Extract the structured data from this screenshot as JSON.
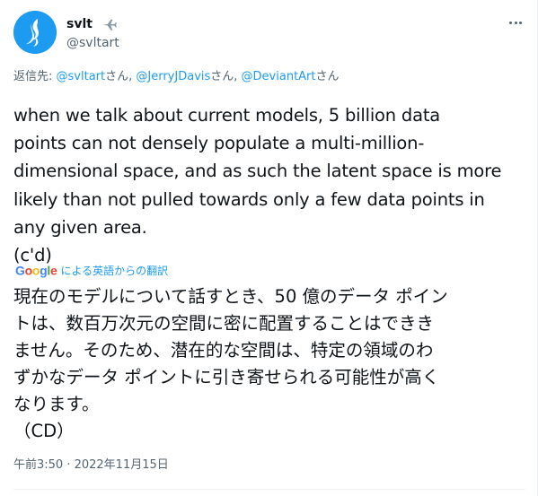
{
  "author": {
    "display_name": "svlt",
    "handle": "@svltart",
    "badge_icon": "airplane-icon",
    "avatar_color": "#1d9bf0"
  },
  "reply": {
    "prefix": "返信先: ",
    "targets": [
      {
        "handle": "@svltart",
        "suffix": "さん"
      },
      {
        "handle": "@JerryJDavis",
        "suffix": "さん"
      },
      {
        "handle": "@DeviantArt",
        "suffix": "さん"
      }
    ],
    "separator": ", "
  },
  "tweet": {
    "text": "when we talk about current models, 5 billion data\npoints can not densely populate a multi-million-\ndimensional space, and as such the latent space is more\nlikely than not pulled towards only a few data points in\nany given area.\n(c'd)"
  },
  "translation": {
    "logo_text": "Google",
    "label": "による英語からの翻訳",
    "text": "現在のモデルについて話すとき、50 億のデータ ポイン\nトは、数百万次元の空間に密に配置することはできき\nません。そのため、潜在的な空間は、特定の領域のわ\nずかなデータ ポイントに引き寄せられる可能性が高く\nなります。\n（CD）"
  },
  "meta": {
    "timestamp": "午前3:50 · 2022年11月15日"
  },
  "colors": {
    "link": "#1d9bf0",
    "secondary_text": "#536471",
    "primary_text": "#0f1419"
  }
}
